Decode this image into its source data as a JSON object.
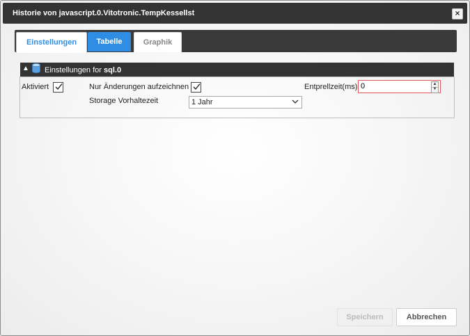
{
  "dialog": {
    "title": "Historie von javascript.0.Vitotronic.TempKessellst",
    "close_glyph": "×",
    "close_icon": "close-icon"
  },
  "tabs": [
    {
      "label": "Einstellungen",
      "state": "active"
    },
    {
      "label": "Tabelle",
      "state": "highlighted"
    },
    {
      "label": "Graphik",
      "state": "inactive"
    }
  ],
  "panel": {
    "collapse_glyph": "▲",
    "icon": "database-icon",
    "title_prefix": "Einstellungen for",
    "title_instance": "sql.0",
    "fields": {
      "aktiviert_label": "Aktiviert",
      "aktiviert_checked": true,
      "nur_aenderungen_label": "Nur Änderungen aufzeichnen",
      "nur_aenderungen_checked": true,
      "entprellzeit_label": "Entprellzeit(ms)",
      "entprellzeit_value": "0",
      "storage_label": "Storage Vorhaltezeit",
      "storage_value": "1 Jahr"
    }
  },
  "buttons": {
    "save_label": "Speichern",
    "save_enabled": false,
    "cancel_label": "Abbrechen"
  },
  "colors": {
    "accent": "#2f8de4",
    "titlebar": "#333333",
    "invalid_border": "#dd5555"
  }
}
